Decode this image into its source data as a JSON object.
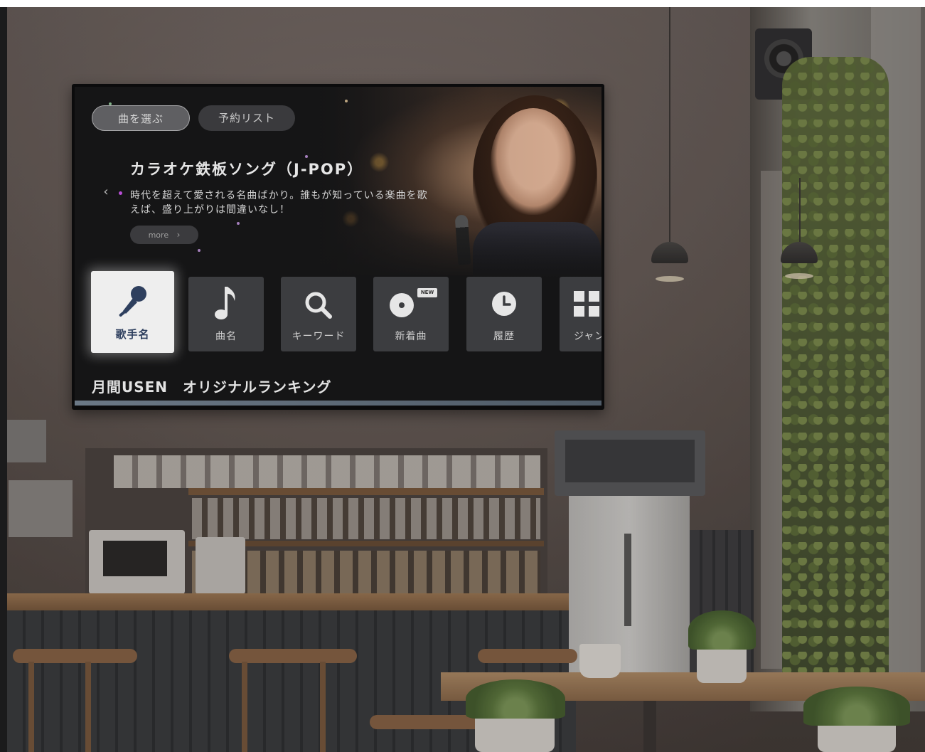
{
  "tabs": [
    {
      "label": "曲を選ぶ",
      "active": true
    },
    {
      "label": "予約リスト",
      "active": false
    }
  ],
  "feature": {
    "title": "カラオケ鉄板ソング（J-POP）",
    "description": "時代を超えて愛される名曲ばかり。誰もが知っている楽曲を歌えば、盛り上がりは間違いなし！",
    "more_label": "more",
    "prev_arrow": "‹"
  },
  "categories": [
    {
      "label": "歌手名",
      "icon": "microphone-icon",
      "selected": true
    },
    {
      "label": "曲名",
      "icon": "music-note-icon",
      "selected": false
    },
    {
      "label": "キーワード",
      "icon": "search-icon",
      "selected": false
    },
    {
      "label": "新着曲",
      "icon": "disc-icon",
      "badge": "NEW",
      "selected": false
    },
    {
      "label": "履歴",
      "icon": "clock-icon",
      "selected": false
    },
    {
      "label": "ジャン",
      "icon": "grid-icon",
      "selected": false
    }
  ],
  "ranking": {
    "title": "月間USEN　オリジナルランキング"
  },
  "colors": {
    "tile_selected_text": "#2e3f5e",
    "tile_bg": "#3c3d40",
    "screen_bg": "#151516"
  }
}
